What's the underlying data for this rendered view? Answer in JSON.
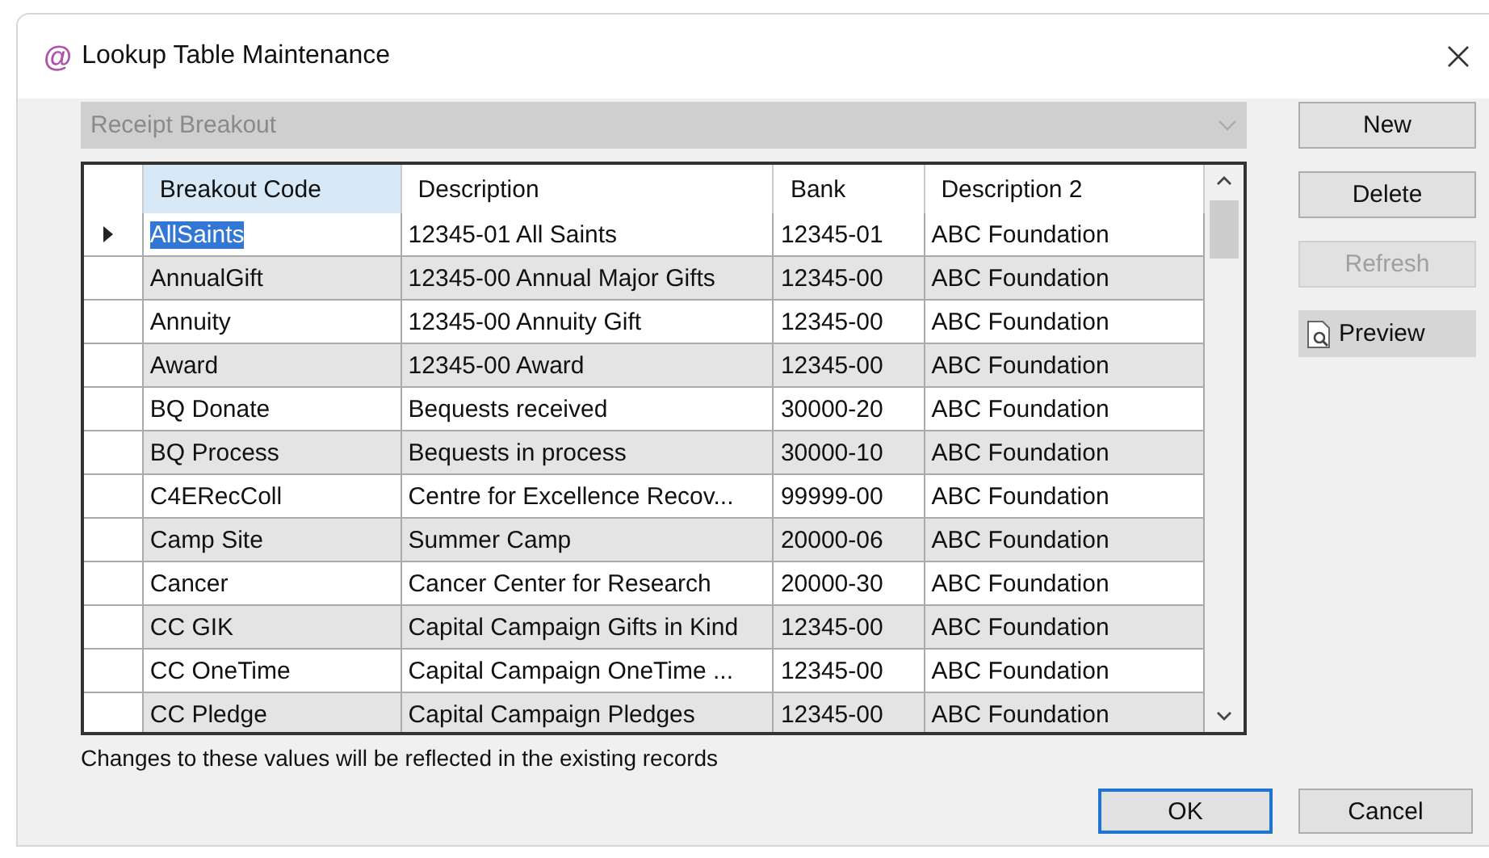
{
  "window": {
    "logo": "@",
    "title": "Lookup Table Maintenance"
  },
  "dropdown": {
    "value": "Receipt Breakout",
    "disabled": true
  },
  "table": {
    "columns": [
      "Breakout Code",
      "Description",
      "Bank",
      "Description 2"
    ],
    "rows": [
      {
        "cells": [
          "AllSaints",
          "12345-01 All Saints",
          "12345-01",
          "ABC Foundation"
        ],
        "selected": true
      },
      {
        "cells": [
          "AnnualGift",
          "12345-00 Annual Major Gifts",
          "12345-00",
          "ABC Foundation"
        ],
        "selected": false
      },
      {
        "cells": [
          "Annuity",
          "12345-00 Annuity Gift",
          "12345-00",
          "ABC Foundation"
        ],
        "selected": false
      },
      {
        "cells": [
          "Award",
          "12345-00 Award",
          "12345-00",
          "ABC Foundation"
        ],
        "selected": false
      },
      {
        "cells": [
          "BQ Donate",
          "Bequests received",
          "30000-20",
          "ABC Foundation"
        ],
        "selected": false
      },
      {
        "cells": [
          "BQ Process",
          "Bequests in process",
          "30000-10",
          "ABC Foundation"
        ],
        "selected": false
      },
      {
        "cells": [
          "C4ERecColl",
          "Centre for Excellence Recov...",
          "99999-00",
          "ABC Foundation"
        ],
        "selected": false
      },
      {
        "cells": [
          "Camp Site",
          "Summer Camp",
          "20000-06",
          "ABC Foundation"
        ],
        "selected": false
      },
      {
        "cells": [
          "Cancer",
          "Cancer Center for Research",
          "20000-30",
          "ABC Foundation"
        ],
        "selected": false
      },
      {
        "cells": [
          "CC GIK",
          "Capital Campaign Gifts in Kind",
          "12345-00",
          "ABC Foundation"
        ],
        "selected": false
      },
      {
        "cells": [
          "CC OneTime",
          "Capital Campaign OneTime ...",
          "12345-00",
          "ABC Foundation"
        ],
        "selected": false
      },
      {
        "cells": [
          "CC Pledge",
          "Capital Campaign Pledges",
          "12345-00",
          "ABC Foundation"
        ],
        "selected": false
      }
    ]
  },
  "side_buttons": [
    {
      "label": "New",
      "disabled": false,
      "kind": "plain"
    },
    {
      "label": "Delete",
      "disabled": false,
      "kind": "plain"
    },
    {
      "label": "Refresh",
      "disabled": true,
      "kind": "plain"
    },
    {
      "label": "Preview",
      "disabled": false,
      "kind": "preview"
    }
  ],
  "note": "Changes to these values will be reflected in the existing records",
  "footer_buttons": [
    {
      "label": "OK",
      "default": true
    },
    {
      "label": "Cancel",
      "default": false
    }
  ]
}
